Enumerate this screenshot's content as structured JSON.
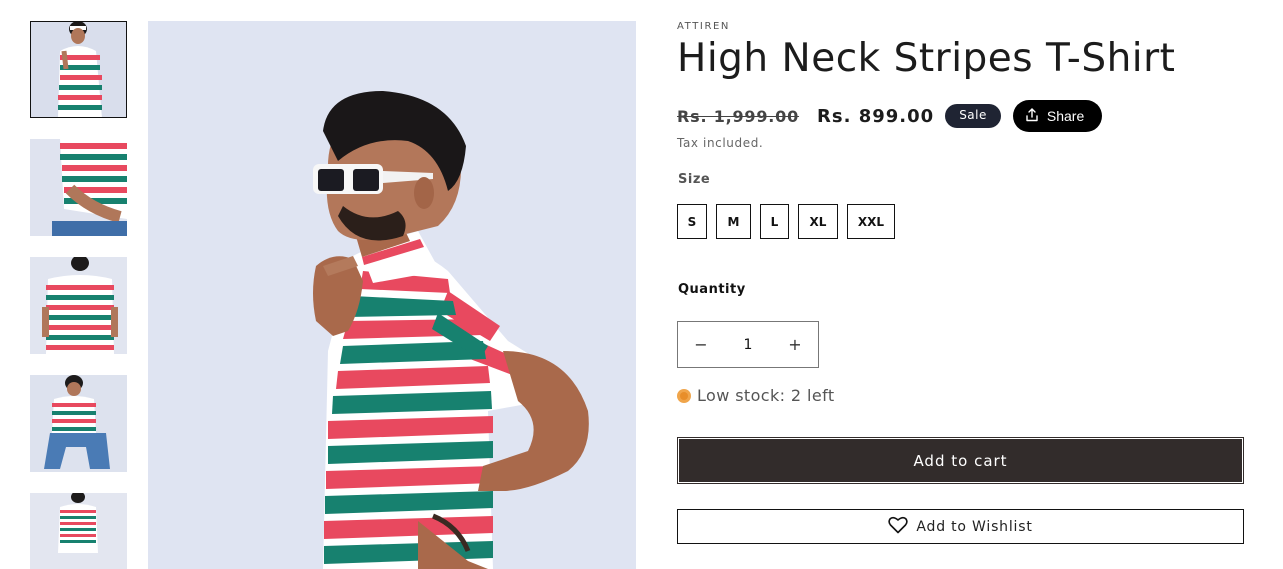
{
  "colors": {
    "badge_bg": "#1f2433",
    "share_bg": "#000000",
    "cart_bg": "#322c2b",
    "stock_dot": "#e88e2a",
    "stripe_red": "#e8495f",
    "stripe_teal": "#17816f",
    "background_photo": "#dfe4f2"
  },
  "gallery": {
    "thumbnails": [
      {
        "name": "front-pose-thumbnail",
        "active": true
      },
      {
        "name": "sleeve-closeup-thumbnail",
        "active": false
      },
      {
        "name": "back-view-thumbnail",
        "active": false
      },
      {
        "name": "seated-pose-thumbnail",
        "active": false
      },
      {
        "name": "front-wide-thumbnail",
        "active": false
      }
    ],
    "main_image": "side-profile-model-photo"
  },
  "product": {
    "vendor": "ATTIREN",
    "title": "High Neck Stripes T-Shirt",
    "price_compare": "Rs. 1,999.00",
    "price_sale": "Rs. 899.00",
    "badge": "Sale",
    "share_label": "Share",
    "tax_note": "Tax included.",
    "size_label": "Size",
    "sizes": [
      "S",
      "M",
      "L",
      "XL",
      "XXL"
    ],
    "quantity_label": "Quantity",
    "quantity_value": "1",
    "quantity_minus": "−",
    "quantity_plus": "+",
    "stock_text": "Low stock: 2 left",
    "add_to_cart": "Add to cart",
    "add_to_wishlist": "Add to Wishlist"
  },
  "icons": {
    "share": "share-icon",
    "heart": "heart-icon",
    "stock": "status-dot-icon"
  }
}
